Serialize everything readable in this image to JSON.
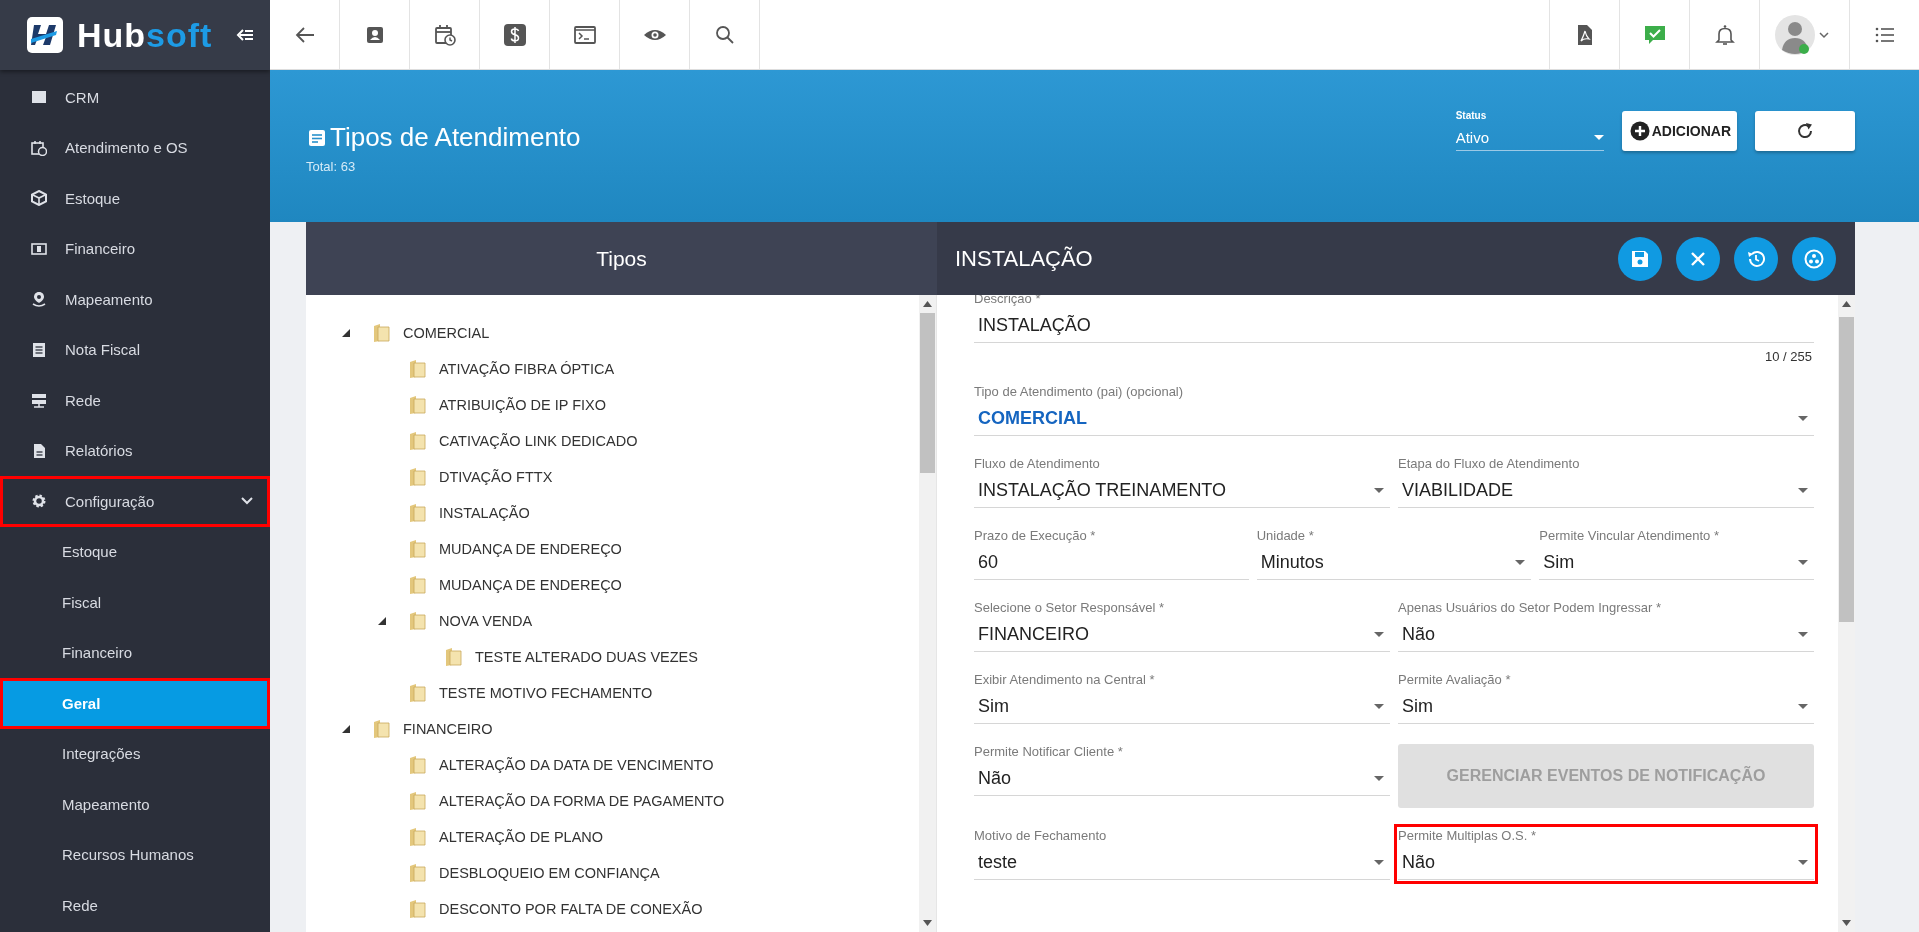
{
  "sidebar": {
    "logo": {
      "part_1": "Hub",
      "part_2": "soft"
    },
    "items": [
      {
        "label": "CRM",
        "kind": "main",
        "selected": false,
        "highlighted": false
      },
      {
        "label": "Atendimento e OS",
        "kind": "main",
        "selected": false,
        "highlighted": false
      },
      {
        "label": "Estoque",
        "kind": "main",
        "selected": false,
        "highlighted": false
      },
      {
        "label": "Financeiro",
        "kind": "main",
        "selected": false,
        "highlighted": false
      },
      {
        "label": "Mapeamento",
        "kind": "main",
        "selected": false,
        "highlighted": false
      },
      {
        "label": "Nota Fiscal",
        "kind": "main",
        "selected": false,
        "highlighted": false
      },
      {
        "label": "Rede",
        "kind": "main",
        "selected": false,
        "highlighted": false
      },
      {
        "label": "Relatórios",
        "kind": "main",
        "selected": false,
        "highlighted": false
      },
      {
        "label": "Configuração",
        "kind": "main",
        "selected": false,
        "highlighted": true,
        "expanded": true
      },
      {
        "label": "Estoque",
        "kind": "sub",
        "selected": false,
        "highlighted": false
      },
      {
        "label": "Fiscal",
        "kind": "sub",
        "selected": false,
        "highlighted": false
      },
      {
        "label": "Financeiro",
        "kind": "sub",
        "selected": false,
        "highlighted": false
      },
      {
        "label": "Geral",
        "kind": "sub",
        "selected": true,
        "highlighted": true
      },
      {
        "label": "Integrações",
        "kind": "sub",
        "selected": false,
        "highlighted": false
      },
      {
        "label": "Mapeamento",
        "kind": "sub",
        "selected": false,
        "highlighted": false
      },
      {
        "label": "Recursos Humanos",
        "kind": "sub",
        "selected": false,
        "highlighted": false
      },
      {
        "label": "Rede",
        "kind": "sub",
        "selected": false,
        "highlighted": false
      }
    ]
  },
  "header": {
    "title": "Tipos de Atendimento",
    "total": "Total: 63",
    "status": {
      "label": "Status",
      "value": "Ativo"
    },
    "add_button": "ADICIONAR"
  },
  "panel": {
    "left_title": "Tipos",
    "right_title": "INSTALAÇÃO",
    "tree": [
      {
        "label": "COMERCIAL",
        "expanded": true,
        "children": [
          {
            "label": "ATIVAÇÃO FIBRA ÓPTICA"
          },
          {
            "label": "ATRIBUIÇÃO DE IP FIXO"
          },
          {
            "label": "CATIVAÇÃO LINK DEDICADO"
          },
          {
            "label": "DTIVAÇÃO FTTX"
          },
          {
            "label": "INSTALAÇÃO"
          },
          {
            "label": "MUDANÇA DE ENDEREÇO"
          },
          {
            "label": "MUDANÇA DE ENDEREÇO"
          },
          {
            "label": "NOVA VENDA",
            "expanded": true,
            "children": [
              {
                "label": "TESTE ALTERADO DUAS VEZES"
              }
            ]
          },
          {
            "label": "TESTE MOTIVO FECHAMENTO"
          }
        ]
      },
      {
        "label": "FINANCEIRO",
        "expanded": true,
        "children": [
          {
            "label": "ALTERAÇÃO DA DATA DE VENCIMENTO"
          },
          {
            "label": "ALTERAÇÃO DA FORMA DE PAGAMENTO"
          },
          {
            "label": "ALTERAÇÃO DE PLANO"
          },
          {
            "label": "DESBLOQUEIO EM CONFIANÇA"
          },
          {
            "label": "DESCONTO POR FALTA DE CONEXÃO"
          }
        ]
      }
    ],
    "form": [
      [
        {
          "kind": "text",
          "label": "Descrição *",
          "value": "INSTALAÇÃO",
          "counter": "10 / 255"
        }
      ],
      [
        {
          "kind": "select",
          "label": "Tipo de Atendimento (pai) (opcional)",
          "value": "COMERCIAL",
          "accent": true
        }
      ],
      [
        {
          "kind": "select",
          "label": "Fluxo de Atendimento",
          "value": "INSTALAÇÃO TREINAMENTO"
        },
        {
          "kind": "select",
          "label": "Etapa do Fluxo de Atendimento",
          "value": "VIABILIDADE"
        }
      ],
      [
        {
          "kind": "text",
          "label": "Prazo de Execução *",
          "value": "60"
        },
        {
          "kind": "select",
          "label": "Unidade *",
          "value": "Minutos"
        },
        {
          "kind": "select",
          "label": "Permite Vincular Atendimento *",
          "value": "Sim"
        }
      ],
      [
        {
          "kind": "select",
          "label": "Selecione o Setor Responsável *",
          "value": "FINANCEIRO"
        },
        {
          "kind": "select",
          "label": "Apenas Usuários do Setor Podem Ingressar *",
          "value": "Não"
        }
      ],
      [
        {
          "kind": "select",
          "label": "Exibir Atendimento na Central *",
          "value": "Sim"
        },
        {
          "kind": "select",
          "label": "Permite Avaliação *",
          "value": "Sim"
        }
      ],
      [
        {
          "kind": "select",
          "label": "Permite Notificar Cliente *",
          "value": "Não"
        },
        {
          "kind": "button",
          "label": "GERENCIAR EVENTOS DE NOTIFICAÇÃO",
          "disabled": true
        }
      ],
      [
        {
          "kind": "select",
          "label": "Motivo de Fechamento",
          "value": "teste"
        },
        {
          "kind": "select",
          "label": "Permite Multiplas O.S. *",
          "value": "Não",
          "highlighted": true
        }
      ]
    ]
  }
}
